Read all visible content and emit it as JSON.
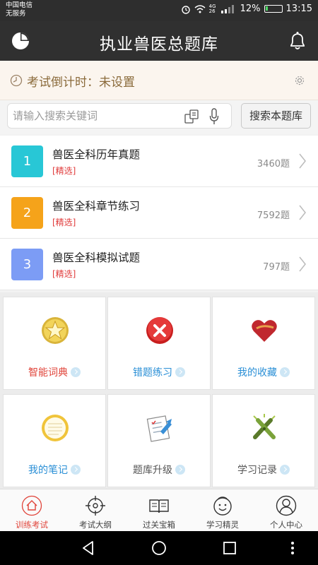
{
  "status_bar": {
    "carrier_line1": "中国电信",
    "carrier_line2": "无服务",
    "network": "4G 26",
    "battery": "12%",
    "time": "13:15"
  },
  "header": {
    "title": "执业兽医总题库",
    "left_icon": "pie-chart-icon",
    "right_icon": "bell-icon"
  },
  "countdown": {
    "text": "考试倒计时：未设置"
  },
  "search": {
    "placeholder": "请输入搜索关键词",
    "button_label": "搜索本题库"
  },
  "question_banks": [
    {
      "number": "1",
      "title": "兽医全科历年真题",
      "tag": "[精选]",
      "count": "3460题",
      "color": "#28c7d6"
    },
    {
      "number": "2",
      "title": "兽医全科章节练习",
      "tag": "[精选]",
      "count": "7592题",
      "color": "#f5a31a"
    },
    {
      "number": "3",
      "title": "兽医全科模拟试题",
      "tag": "[精选]",
      "count": "797题",
      "color": "#7c9cf5"
    }
  ],
  "feature_grid": [
    {
      "label": "智能词典",
      "icon": "star-icon",
      "color": "#e0443a"
    },
    {
      "label": "错题练习",
      "icon": "wrong-x-icon",
      "color": "#2a8fd6"
    },
    {
      "label": "我的收藏",
      "icon": "heart-icon",
      "color": "#2a8fd6"
    },
    {
      "label": "我的笔记",
      "icon": "notepad-icon",
      "color": "#2a8fd6"
    },
    {
      "label": "题库升级",
      "icon": "upgrade-checklist-icon",
      "color": "#555555"
    },
    {
      "label": "学习记录",
      "icon": "pencils-icon",
      "color": "#555555"
    }
  ],
  "tab_bar": [
    {
      "label": "训练考试",
      "icon": "home-icon",
      "active": true
    },
    {
      "label": "考试大纲",
      "icon": "target-icon",
      "active": false
    },
    {
      "label": "过关宝箱",
      "icon": "book-icon",
      "active": false
    },
    {
      "label": "学习精灵",
      "icon": "smiley-icon",
      "active": false
    },
    {
      "label": "个人中心",
      "icon": "user-icon",
      "active": false
    }
  ]
}
